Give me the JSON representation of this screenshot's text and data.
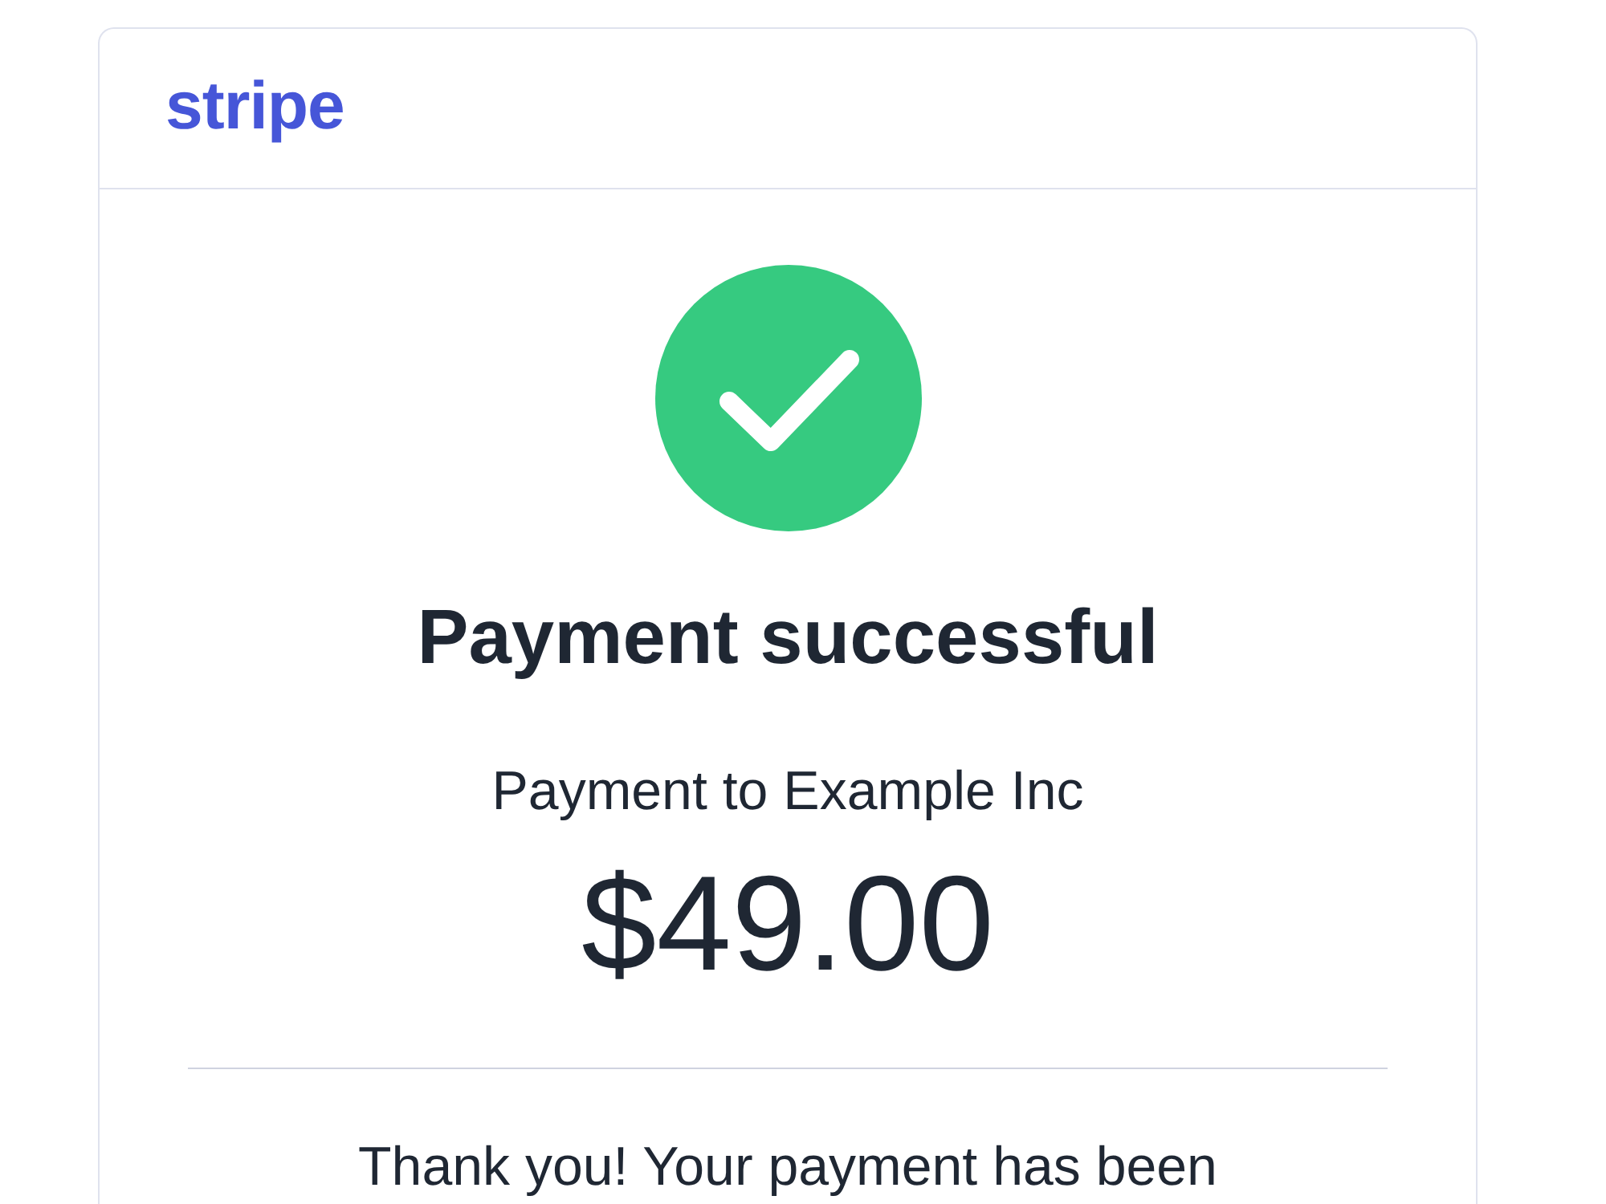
{
  "header": {
    "logo": "stripe"
  },
  "status": {
    "kind": "success",
    "title": "Payment successful",
    "recipient": "Payment to Example Inc",
    "amount": "$49.00"
  },
  "message": "Thank you! Your payment has been"
}
